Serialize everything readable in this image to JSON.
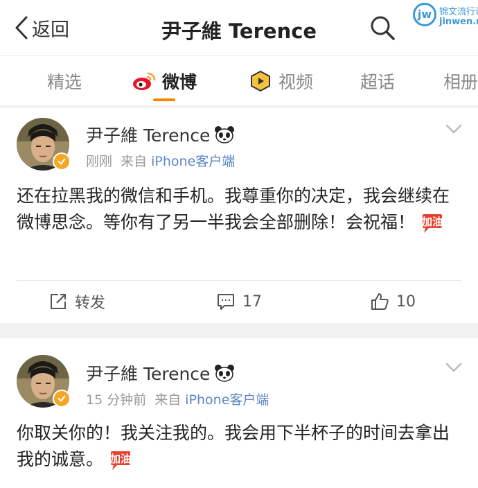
{
  "header": {
    "back_label": "返回",
    "title": "尹子維 Terence"
  },
  "watermark": {
    "logo": "jw",
    "line1": "锦文流行语",
    "line2": "jinwen.net"
  },
  "tabs": [
    {
      "label": "精选"
    },
    {
      "label": "微博",
      "icon": "weibo-icon",
      "active": true
    },
    {
      "label": "视频",
      "icon": "video-icon"
    },
    {
      "label": "超话"
    },
    {
      "label": "相册"
    }
  ],
  "posts": [
    {
      "author": "尹子維 Terence",
      "time": "刚刚",
      "source_prefix": "来自",
      "source": "iPhone客户端",
      "text": "还在拉黑我的微信和手机。我尊重你的决定，我会继续在微博思念。等你有了另一半我会全部删除！会祝福！",
      "emoji": "加油",
      "repost_label": "转发",
      "comments": "17",
      "likes": "10"
    },
    {
      "author": "尹子維 Terence",
      "time": "15 分钟前",
      "source_prefix": "来自",
      "source": "iPhone客户端",
      "text": "你取关你的！我关注我的。我会用下半杯子的时间去拿出我的诚意。",
      "emoji": "加油"
    }
  ],
  "colors": {
    "accent": "#ff8200",
    "link": "#5b87c2",
    "verified": "#f6a623"
  }
}
